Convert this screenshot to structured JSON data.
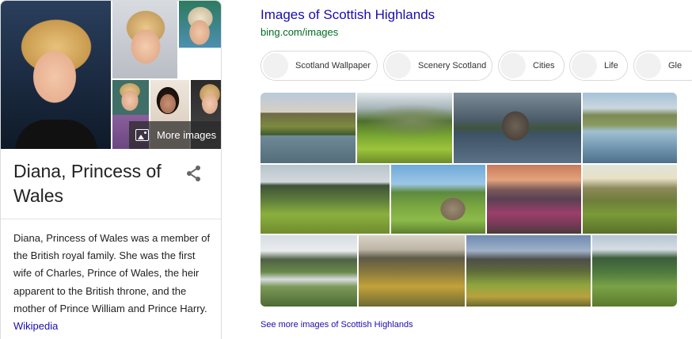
{
  "knowledge_panel": {
    "more_images_label": "More images",
    "title": "Diana, Princess of Wales",
    "description": "Diana, Princess of Wales was a member of the British royal family. She was the first wife of Charles, Prince of Wales, the heir apparent to the British throne, and the mother of Prince William and Prince Harry.",
    "source_link": "Wikipedia",
    "icons": {
      "share": "share-icon",
      "images": "image-icon"
    }
  },
  "image_answer": {
    "title": "Images of Scottish Highlands",
    "url": "bing.com/images",
    "chips": [
      {
        "label": "Scotland Wallpaper"
      },
      {
        "label": "Scenery Scotland"
      },
      {
        "label": "Cities"
      },
      {
        "label": "Life"
      },
      {
        "label": "Gle"
      }
    ],
    "see_more": "See more images of Scottish Highlands"
  },
  "colors": {
    "link": "#1a0dab",
    "url_green": "#006d21",
    "text": "#222222",
    "border": "#dcdcdc"
  }
}
